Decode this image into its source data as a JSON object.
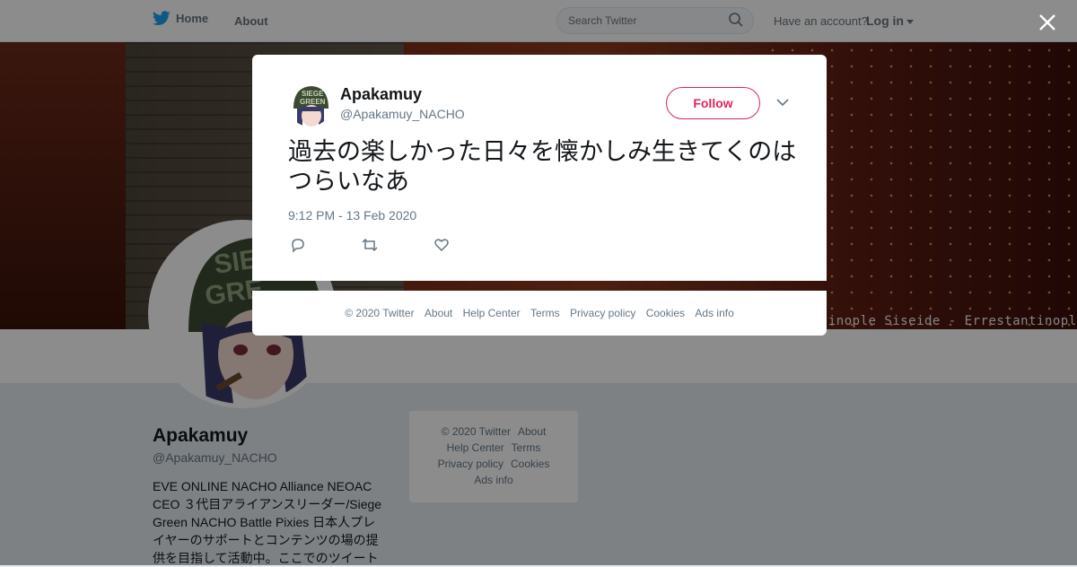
{
  "topbar": {
    "home_label": "Home",
    "about_label": "About",
    "search_placeholder": "Search Twitter",
    "have_account": "Have an account?",
    "login_label": "Log in"
  },
  "banner": {
    "overlay_text": "Kebostar + [SGGKN B FIX] Siseide - Errestantinople Siseide - Errestantinople"
  },
  "profile": {
    "name": "Apakamuy",
    "handle": "@Apakamuy_NACHO",
    "bio": "EVE ONLINE NACHO Alliance NEOAC CEO ３代目アライアンスリーダー/Siege Green NACHO Battle Pixies 日本人プレイヤーのサポートとコンテンツの場の提供を目指して活動中。ここでのツイート"
  },
  "side_footer": {
    "items": [
      "© 2020 Twitter",
      "About",
      "Help Center",
      "Terms",
      "Privacy policy",
      "Cookies",
      "Ads info"
    ]
  },
  "tweet": {
    "name": "Apakamuy",
    "handle": "@Apakamuy_NACHO",
    "follow_label": "Follow",
    "text": "過去の楽しかった日々を懐かしみ生きてくのはつらいなあ",
    "timestamp": "9:12 PM - 13 Feb 2020"
  },
  "modal_footer": {
    "items": [
      "© 2020 Twitter",
      "About",
      "Help Center",
      "Terms",
      "Privacy policy",
      "Cookies",
      "Ads info"
    ]
  },
  "icons": {
    "brand": "twitter-bird-icon",
    "search": "search-icon",
    "close": "close-icon",
    "menu": "chevron-down-icon",
    "reply": "reply-icon",
    "retweet": "retweet-icon",
    "like": "heart-icon"
  },
  "colors": {
    "brand_blue": "#1da1f2",
    "follow_red": "#e0245e",
    "muted": "#657786",
    "text": "#14171a"
  }
}
